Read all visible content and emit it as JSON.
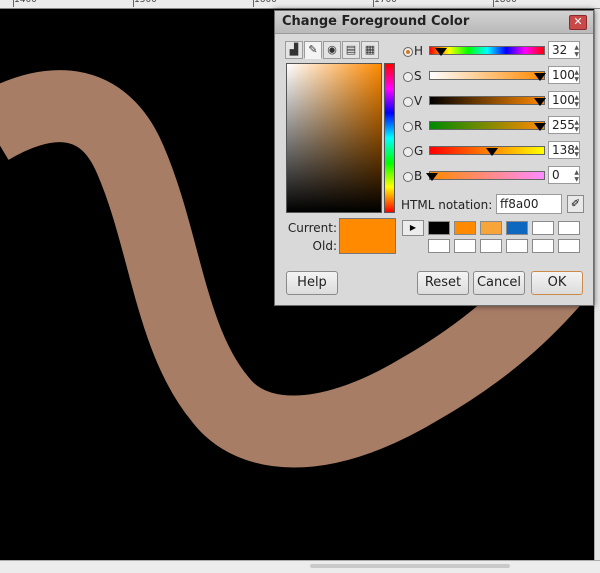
{
  "ruler": {
    "labels": [
      "1400",
      "1500",
      "1600",
      "1700",
      "1800"
    ]
  },
  "canvas": {
    "stroke_color": "#a87d66",
    "background": "#000000"
  },
  "dialog": {
    "title": "Change Foreground Color",
    "tabs": [
      "brush-icon",
      "color-wheel-icon",
      "printer-icon",
      "palette-icon"
    ],
    "channels": [
      {
        "id": "H",
        "label": "H",
        "value": "32",
        "selected": true
      },
      {
        "id": "S",
        "label": "S",
        "value": "100",
        "selected": false
      },
      {
        "id": "V",
        "label": "V",
        "value": "100",
        "selected": false
      },
      {
        "id": "R",
        "label": "R",
        "value": "255",
        "selected": false
      },
      {
        "id": "G",
        "label": "G",
        "value": "138",
        "selected": false
      },
      {
        "id": "B",
        "label": "B",
        "value": "0",
        "selected": false
      }
    ],
    "html_notation_label": "HTML notation:",
    "html_notation_value": "ff8a00",
    "current_label": "Current:",
    "old_label": "Old:",
    "current_color": "#ff8a00",
    "history_colors": [
      "#000000",
      "#ff8a00",
      "#f7a43a",
      "#0f68c0",
      "#ffffff",
      "#ffffff",
      "#ffffff",
      "#ffffff",
      "#ffffff",
      "#ffffff",
      "#ffffff",
      "#ffffff"
    ],
    "buttons": {
      "help": "Help",
      "reset": "Reset",
      "cancel": "Cancel",
      "ok": "OK"
    }
  }
}
